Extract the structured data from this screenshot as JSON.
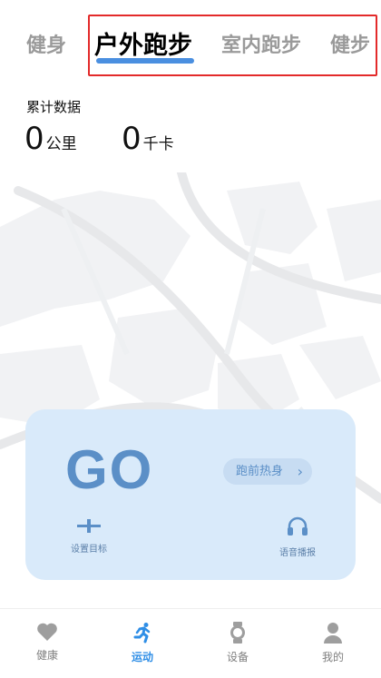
{
  "tabs": [
    {
      "label": "健身"
    },
    {
      "label": "户外跑步",
      "active": true
    },
    {
      "label": "室内跑步"
    },
    {
      "label": "健步"
    }
  ],
  "stats": {
    "title": "累计数据",
    "distance": {
      "value": "0",
      "unit": "公里"
    },
    "calories": {
      "value": "0",
      "unit": "千卡"
    }
  },
  "card": {
    "go_label": "GO",
    "warmup_label": "跑前热身",
    "target_label": "设置目标",
    "voice_label": "语音播报"
  },
  "nav": [
    {
      "label": "健康",
      "icon": "heart-icon"
    },
    {
      "label": "运动",
      "icon": "running-icon",
      "active": true
    },
    {
      "label": "设备",
      "icon": "watch-icon"
    },
    {
      "label": "我的",
      "icon": "person-icon"
    }
  ],
  "colors": {
    "accent": "#2f8ee6",
    "card_bg": "#d9eafa",
    "go_text": "#5b8fc7",
    "highlight_box": "#e32a2a"
  }
}
